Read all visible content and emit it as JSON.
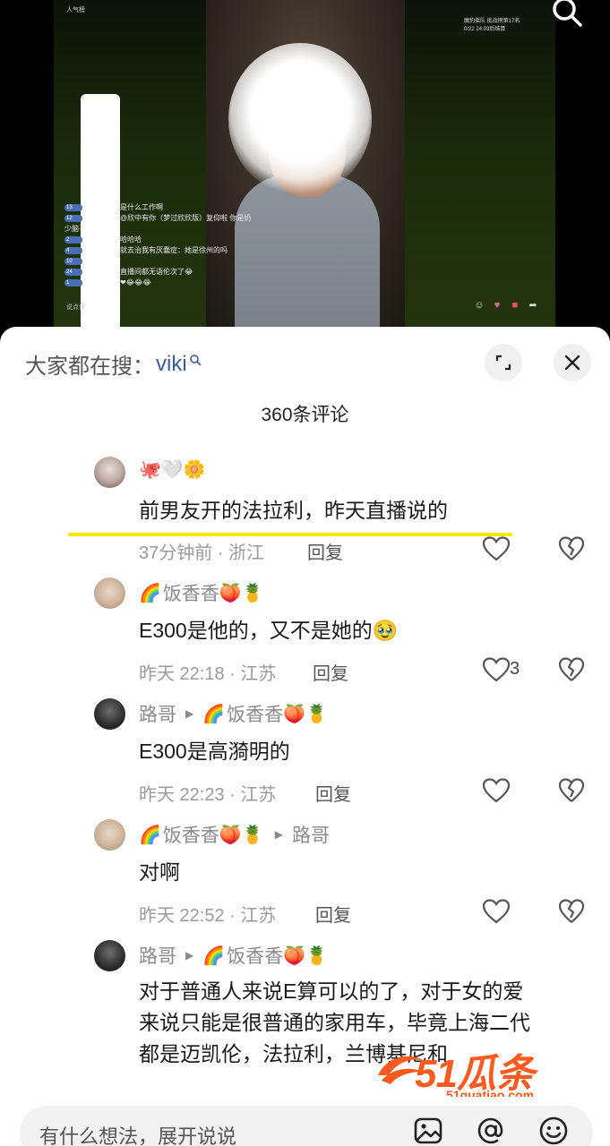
{
  "video": {
    "popularity_label": "人气榜",
    "stats_line1": "魔豹摇队  挑战榜第17名",
    "stats_line2": "0/22      24:03后结算",
    "live_chat": [
      {
        "level": "13",
        "text": "是什么工作啊"
      },
      {
        "level": "12",
        "text": "@欣中有你（梦过欣欣版）复仰啦 你是奶"
      },
      {
        "level": "",
        "text": "少脑子"
      },
      {
        "level": "2",
        "text": "哈哈哈"
      },
      {
        "level": "4",
        "text": "就去治我有厌蠢症：她是徐州的吗"
      },
      {
        "level": "10",
        "text": ""
      },
      {
        "level": "24",
        "text": "直播间都无语伦次了😂"
      },
      {
        "level": "1",
        "text": "❤😂😂😂"
      }
    ],
    "chat_input_hint": "说点什"
  },
  "sheet": {
    "search_prefix": "大家都在搜：",
    "search_keyword": "viki",
    "comment_count": "360条评论"
  },
  "comments": [
    {
      "user": "",
      "user_emojis": "🐙🤍🌼",
      "reply_to": "",
      "text": "前男友开的法拉利，昨天直播说的",
      "time_location": "37分钟前 · 浙江",
      "reply_label": "回复",
      "likes": ""
    },
    {
      "user": "饭香香",
      "user_prefix_emoji": "🌈",
      "user_emojis": "🍑🍍",
      "reply_to": "",
      "text": "E300是他的，又不是她的🥹",
      "time_location": "昨天 22:18 · 江苏",
      "reply_label": "回复",
      "likes": "3"
    },
    {
      "user": "路哥",
      "reply_to": "饭香香",
      "reply_to_prefix_emoji": "🌈",
      "reply_to_emojis": "🍑🍍",
      "text": "E300是高漪明的",
      "time_location": "昨天 22:23 · 江苏",
      "reply_label": "回复",
      "likes": ""
    },
    {
      "user": "饭香香",
      "user_prefix_emoji": "🌈",
      "user_emojis": "🍑🍍",
      "reply_to": "路哥",
      "text": "对啊",
      "time_location": "昨天 22:52 · 江苏",
      "reply_label": "回复",
      "likes": ""
    },
    {
      "user": "路哥",
      "reply_to": "饭香香",
      "reply_to_prefix_emoji": "🌈",
      "reply_to_emojis": "🍑🍍",
      "text_lines": [
        "对于普通人来说E算可以的了，对于女的爱",
        "来说只能是很普通的家用车，毕竟上海二代",
        "都是迈凯伦，法拉利，兰博基尼和"
      ]
    }
  ],
  "watermark": {
    "main": "51瓜条",
    "sub": "51guatiao.com"
  },
  "bottom_bar": {
    "placeholder": "有什么想法，展开说说"
  },
  "colors": {
    "highlight": "#ffe600",
    "keyword": "#3a5e95",
    "watermark": "#ff5a1f"
  }
}
